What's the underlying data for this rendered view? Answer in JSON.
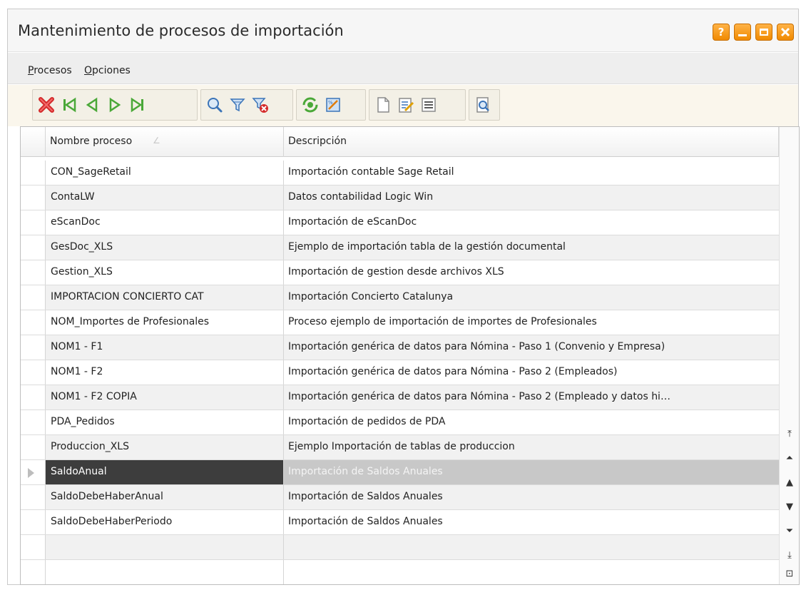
{
  "window": {
    "title": "Mantenimiento de procesos de importación",
    "help_label": "?"
  },
  "menu": [
    {
      "label": "Procesos"
    },
    {
      "label": "Opciones"
    }
  ],
  "toolbar": {
    "icons": [
      "delete-icon",
      "first-record-icon",
      "previous-record-icon",
      "next-record-icon",
      "last-record-icon",
      "search-icon",
      "filter-icon",
      "clear-filter-icon",
      "refresh-icon",
      "report-design-icon",
      "new-document-icon",
      "edit-document-icon",
      "list-view-icon",
      "print-preview-icon"
    ]
  },
  "grid": {
    "columns": [
      "Nombre proceso",
      "Descripción"
    ],
    "sort_indicator": "∠",
    "rows": [
      {
        "name": "CON_SageRetail",
        "desc": "Importación contable Sage Retail"
      },
      {
        "name": "ContaLW",
        "desc": "Datos contabilidad Logic Win"
      },
      {
        "name": "eScanDoc",
        "desc": "Importación de eScanDoc"
      },
      {
        "name": "GesDoc_XLS",
        "desc": "Ejemplo de importación tabla de la gestión documental"
      },
      {
        "name": "Gestion_XLS",
        "desc": "Importación de gestion desde archivos XLS"
      },
      {
        "name": "IMPORTACION CONCIERTO CAT",
        "desc": "Importación Concierto Catalunya"
      },
      {
        "name": "NOM_Importes de Profesionales",
        "desc": "Proceso ejemplo de importación de importes de Profesionales"
      },
      {
        "name": "NOM1 - F1",
        "desc": "Importación genérica de datos para Nómina - Paso 1 (Convenio y Empresa)"
      },
      {
        "name": "NOM1 - F2",
        "desc": "Importación genérica de datos para Nómina - Paso 2 (Empleados)"
      },
      {
        "name": "NOM1 - F2 COPIA",
        "desc": "Importación genérica de datos para Nómina - Paso 2 (Empleado y datos hi…"
      },
      {
        "name": "PDA_Pedidos",
        "desc": "Importación de pedidos de PDA"
      },
      {
        "name": "Produccion_XLS",
        "desc": "Ejemplo Importación de tablas de produccion"
      },
      {
        "name": "SaldoAnual",
        "desc": "Importación de Saldos Anuales",
        "selected": true
      },
      {
        "name": "SaldoDebeHaberAnual",
        "desc": "Importación de Saldos Anuales"
      },
      {
        "name": "SaldoDebeHaberPeriodo",
        "desc": "Importación de Saldos Anuales"
      },
      {
        "name": "",
        "desc": ""
      },
      {
        "name": "",
        "desc": ""
      }
    ]
  },
  "scroll_buttons": [
    {
      "name": "scroll-first-page-icon",
      "glyph": "⤒"
    },
    {
      "name": "scroll-page-up-icon",
      "glyph": "⏶"
    },
    {
      "name": "scroll-line-up-icon",
      "glyph": "▲"
    },
    {
      "name": "scroll-line-down-icon",
      "glyph": "▼"
    },
    {
      "name": "scroll-page-down-icon",
      "glyph": "⏷"
    },
    {
      "name": "scroll-last-page-icon",
      "glyph": "⤓"
    },
    {
      "name": "scroll-exit-icon",
      "glyph": "⊡"
    }
  ],
  "colors": {
    "accent_orange": "#f08a00",
    "selected_row_dark": "#3d3d3d",
    "selected_row_light": "#c8c8c8",
    "toolbar_bg": "#faf6ec"
  }
}
